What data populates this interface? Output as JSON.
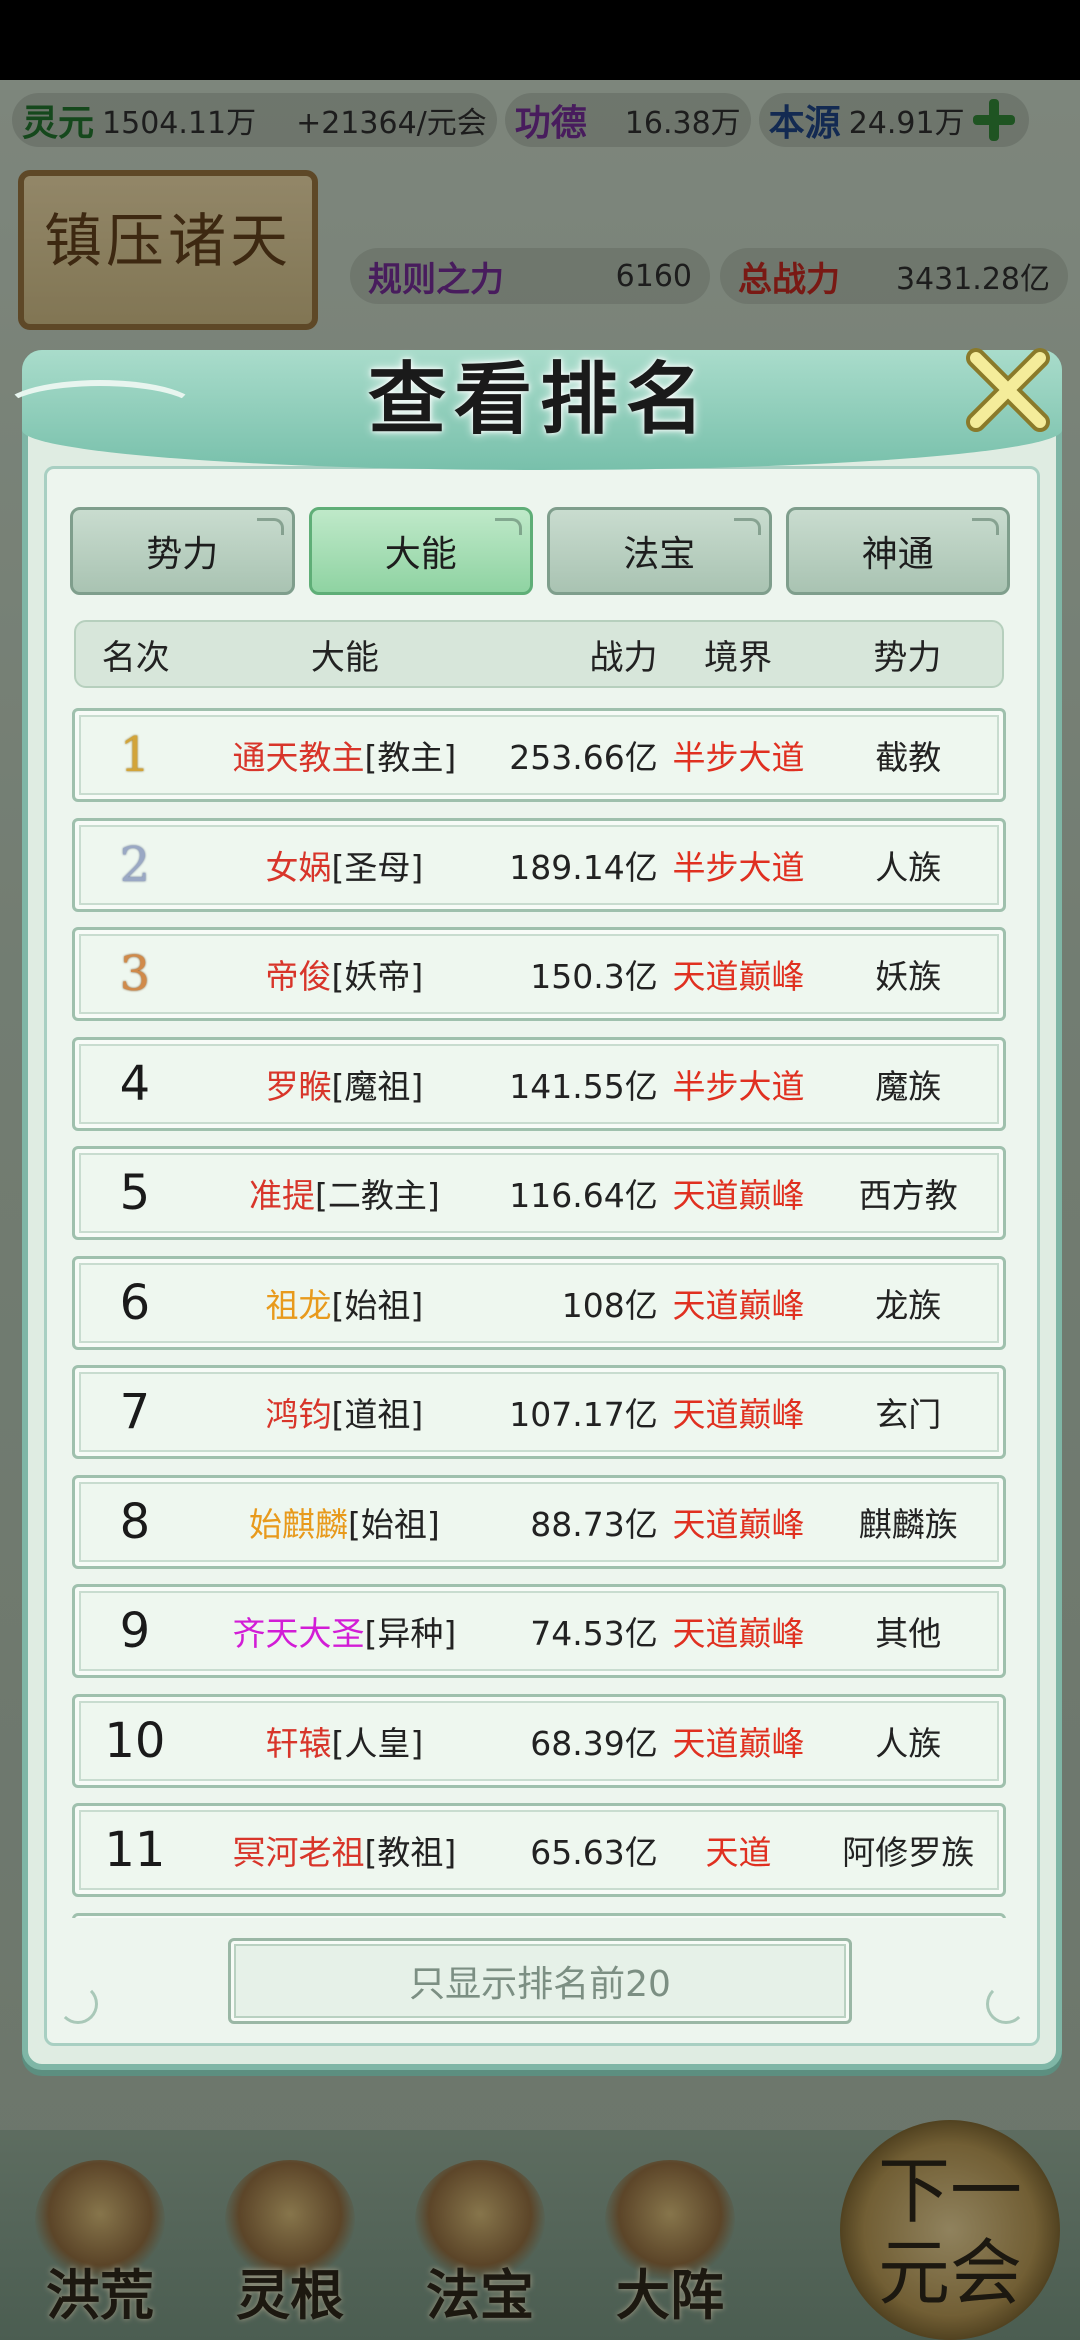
{
  "background": {
    "resources": [
      {
        "name": "灵元",
        "value": "1504.11万",
        "color": "green"
      },
      {
        "name": "",
        "value": "+21364/元会",
        "color": ""
      },
      {
        "name": "功德",
        "value": "16.38万",
        "color": "purple"
      },
      {
        "name": "本源",
        "value": "24.91万",
        "color": "blue"
      }
    ],
    "plaque_title": "镇压诸天",
    "stats": [
      {
        "label": "规则之力",
        "value": "6160"
      },
      {
        "label": "总战力",
        "value": "3431.28亿"
      }
    ],
    "nav": [
      "洪荒",
      "灵根",
      "法宝",
      "大阵"
    ],
    "next_button": "下一元会"
  },
  "modal": {
    "title": "查看排名",
    "tabs": [
      {
        "label": "势力",
        "active": false
      },
      {
        "label": "大能",
        "active": true
      },
      {
        "label": "法宝",
        "active": false
      },
      {
        "label": "神通",
        "active": false
      }
    ],
    "columns": [
      "名次",
      "大能",
      "战力",
      "境界",
      "势力"
    ],
    "rows": [
      {
        "rank": "1",
        "name": "通天教主",
        "title": "[教主]",
        "power": "253.66亿",
        "realm": "半步大道",
        "faction": "截教",
        "name_color": "red",
        "rank_style": "gold"
      },
      {
        "rank": "2",
        "name": "女娲",
        "title": "[圣母]",
        "power": "189.14亿",
        "realm": "半步大道",
        "faction": "人族",
        "name_color": "red",
        "rank_style": "silver"
      },
      {
        "rank": "3",
        "name": "帝俊",
        "title": "[妖帝]",
        "power": "150.3亿",
        "realm": "天道巅峰",
        "faction": "妖族",
        "name_color": "red",
        "rank_style": "bronze"
      },
      {
        "rank": "4",
        "name": "罗睺",
        "title": "[魔祖]",
        "power": "141.55亿",
        "realm": "半步大道",
        "faction": "魔族",
        "name_color": "red",
        "rank_style": ""
      },
      {
        "rank": "5",
        "name": "准提",
        "title": "[二教主]",
        "power": "116.64亿",
        "realm": "天道巅峰",
        "faction": "西方教",
        "name_color": "red",
        "rank_style": ""
      },
      {
        "rank": "6",
        "name": "祖龙",
        "title": "[始祖]",
        "power": "108亿",
        "realm": "天道巅峰",
        "faction": "龙族",
        "name_color": "orange",
        "rank_style": ""
      },
      {
        "rank": "7",
        "name": "鸿钧",
        "title": "[道祖]",
        "power": "107.17亿",
        "realm": "天道巅峰",
        "faction": "玄门",
        "name_color": "red",
        "rank_style": ""
      },
      {
        "rank": "8",
        "name": "始麒麟",
        "title": "[始祖]",
        "power": "88.73亿",
        "realm": "天道巅峰",
        "faction": "麒麟族",
        "name_color": "orange",
        "rank_style": ""
      },
      {
        "rank": "9",
        "name": "齐天大圣",
        "title": "[异种]",
        "power": "74.53亿",
        "realm": "天道巅峰",
        "faction": "其他",
        "name_color": "magenta",
        "rank_style": ""
      },
      {
        "rank": "10",
        "name": "轩辕",
        "title": "[人皇]",
        "power": "68.39亿",
        "realm": "天道巅峰",
        "faction": "人族",
        "name_color": "red",
        "rank_style": ""
      },
      {
        "rank": "11",
        "name": "冥河老祖",
        "title": "[教祖]",
        "power": "65.63亿",
        "realm": "天道",
        "faction": "阿修罗族",
        "name_color": "red",
        "rank_style": ""
      }
    ],
    "filter_button": "只显示排名前20"
  }
}
